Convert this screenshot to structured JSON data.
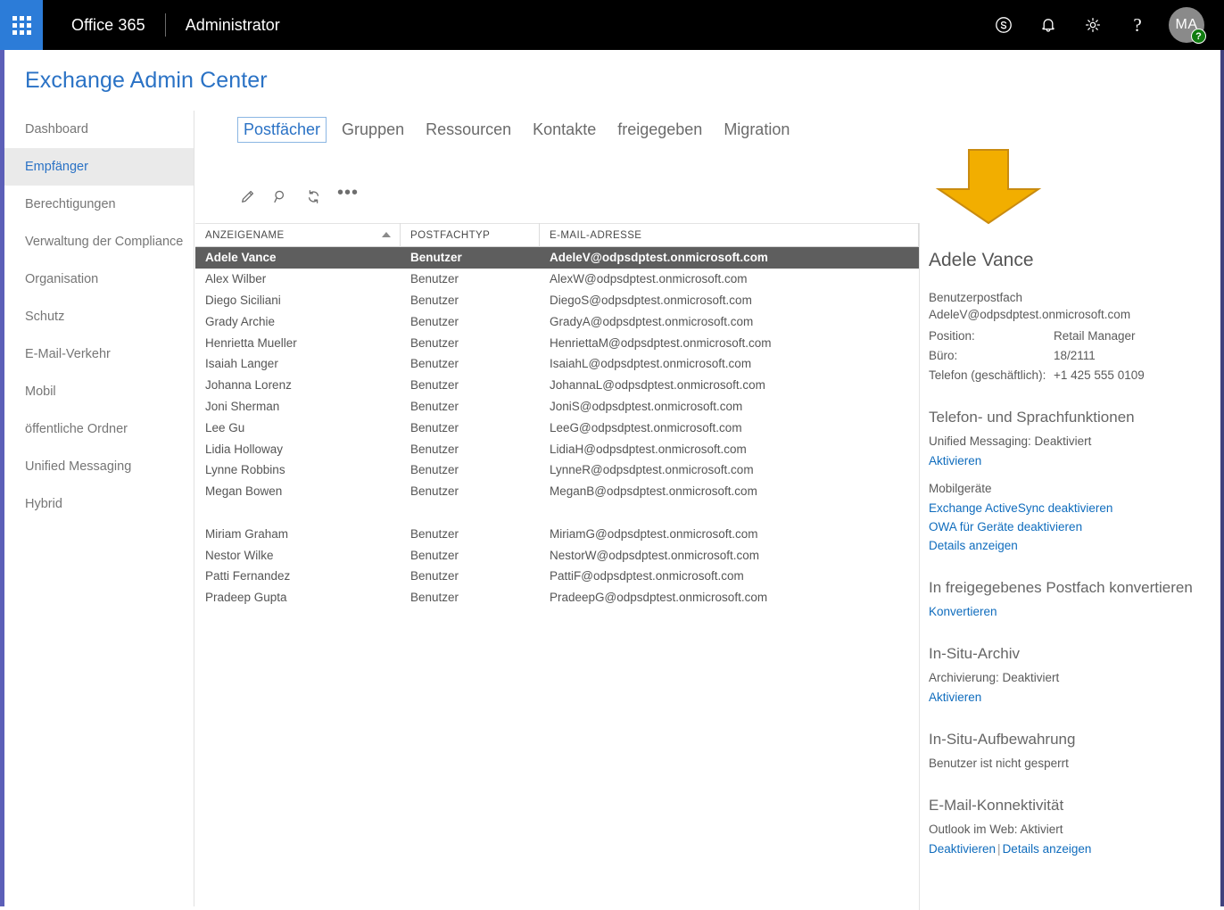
{
  "suitebar": {
    "waffle_label": "app-launcher",
    "brand": "Office 365",
    "subtitle": "Administrator",
    "icons": [
      "skype-icon",
      "bell-icon",
      "gear-icon",
      "help-icon"
    ],
    "help_glyph": "?",
    "avatar_initials": "MA",
    "avatar_badge_glyph": "?",
    "colors": {
      "bar_bg": "#000000",
      "waffle_bg": "#2c7cd8",
      "badge": "#107c10"
    }
  },
  "page": {
    "title": "Exchange Admin Center",
    "title_color": "#2a72c5"
  },
  "sidebar": {
    "items": [
      {
        "label": "Dashboard",
        "selected": false
      },
      {
        "label": "Empfänger",
        "selected": true
      },
      {
        "label": "Berechtigungen",
        "selected": false
      },
      {
        "label": "Verwaltung der Compliance",
        "selected": false
      },
      {
        "label": "Organisation",
        "selected": false
      },
      {
        "label": "Schutz",
        "selected": false
      },
      {
        "label": "E-Mail-Verkehr",
        "selected": false
      },
      {
        "label": "Mobil",
        "selected": false
      },
      {
        "label": "öffentliche Ordner",
        "selected": false
      },
      {
        "label": "Unified Messaging",
        "selected": false
      },
      {
        "label": "Hybrid",
        "selected": false
      }
    ]
  },
  "tabs": [
    {
      "label": "Postfächer",
      "active": true
    },
    {
      "label": "Gruppen",
      "active": false
    },
    {
      "label": "Ressourcen",
      "active": false
    },
    {
      "label": "Kontakte",
      "active": false
    },
    {
      "label": "freigegeben",
      "active": false
    },
    {
      "label": "Migration",
      "active": false
    }
  ],
  "toolbar": {
    "buttons": [
      "edit-pencil-icon",
      "search-icon",
      "refresh-icon",
      "more-options-icon"
    ],
    "more_glyph": "•••"
  },
  "table": {
    "columns": [
      "ANZEIGENAME",
      "POSTFACHTYP",
      "E-MAIL-ADRESSE"
    ],
    "sort_column": "ANZEIGENAME",
    "sort_direction": "ascending",
    "rows": [
      {
        "name": "Adele Vance",
        "type": "Benutzer",
        "email": "AdeleV@odpsdptest.onmicrosoft.com",
        "selected": true
      },
      {
        "name": "Alex Wilber",
        "type": "Benutzer",
        "email": "AlexW@odpsdptest.onmicrosoft.com",
        "selected": false
      },
      {
        "name": "Diego Siciliani",
        "type": "Benutzer",
        "email": "DiegoS@odpsdptest.onmicrosoft.com",
        "selected": false
      },
      {
        "name": "Grady Archie",
        "type": "Benutzer",
        "email": "GradyA@odpsdptest.onmicrosoft.com",
        "selected": false
      },
      {
        "name": "Henrietta Mueller",
        "type": "Benutzer",
        "email": "HenriettaM@odpsdptest.onmicrosoft.com",
        "selected": false
      },
      {
        "name": "Isaiah Langer",
        "type": "Benutzer",
        "email": "IsaiahL@odpsdptest.onmicrosoft.com",
        "selected": false
      },
      {
        "name": "Johanna Lorenz",
        "type": "Benutzer",
        "email": "JohannaL@odpsdptest.onmicrosoft.com",
        "selected": false
      },
      {
        "name": "Joni Sherman",
        "type": "Benutzer",
        "email": "JoniS@odpsdptest.onmicrosoft.com",
        "selected": false
      },
      {
        "name": "Lee Gu",
        "type": "Benutzer",
        "email": "LeeG@odpsdptest.onmicrosoft.com",
        "selected": false
      },
      {
        "name": "Lidia Holloway",
        "type": "Benutzer",
        "email": "LidiaH@odpsdptest.onmicrosoft.com",
        "selected": false
      },
      {
        "name": "Lynne Robbins",
        "type": "Benutzer",
        "email": "LynneR@odpsdptest.onmicrosoft.com",
        "selected": false
      },
      {
        "name": "Megan Bowen",
        "type": "Benutzer",
        "email": "MeganB@odpsdptest.onmicrosoft.com",
        "selected": false
      },
      {
        "name": "",
        "type": "",
        "email": "",
        "selected": false
      },
      {
        "name": "Miriam Graham",
        "type": "Benutzer",
        "email": "MiriamG@odpsdptest.onmicrosoft.com",
        "selected": false
      },
      {
        "name": "Nestor Wilke",
        "type": "Benutzer",
        "email": "NestorW@odpsdptest.onmicrosoft.com",
        "selected": false
      },
      {
        "name": "Patti Fernandez",
        "type": "Benutzer",
        "email": "PattiF@odpsdptest.onmicrosoft.com",
        "selected": false
      },
      {
        "name": "Pradeep Gupta",
        "type": "Benutzer",
        "email": "PradeepG@odpsdptest.onmicrosoft.com",
        "selected": false
      }
    ]
  },
  "details": {
    "display_name": "Adele Vance",
    "mailbox_type": "Benutzerpostfach",
    "email": "AdeleV@odpsdptest.onmicrosoft.com",
    "position_label": "Position:",
    "position_value": "Retail Manager",
    "office_label": "Büro:",
    "office_value": "18/2111",
    "phone_label": "Telefon (geschäftlich):",
    "phone_value": "+1 425 555 0109",
    "voice": {
      "heading": "Telefon- und Sprachfunktionen",
      "um_status": "Unified Messaging:  Deaktiviert",
      "um_link": "Aktivieren",
      "mobile_sub": "Mobilgeräte",
      "link_activesync": "Exchange ActiveSync deaktivieren",
      "link_owa_devices": "OWA für Geräte deaktivieren",
      "link_details": "Details anzeigen"
    },
    "convert": {
      "heading": "In freigegebenes Postfach konvertieren",
      "link": "Konvertieren"
    },
    "archive": {
      "heading": "In-Situ-Archiv",
      "status": "Archivierung:  Deaktiviert",
      "link": "Aktivieren"
    },
    "hold": {
      "heading": "In-Situ-Aufbewahrung",
      "status": "Benutzer ist nicht gesperrt"
    },
    "connectivity": {
      "heading": "E-Mail-Konnektivität",
      "status": "Outlook im Web:  Aktiviert",
      "link_disable": "Deaktivieren",
      "separator": "|",
      "link_details": "Details anzeigen"
    },
    "link_color": "#0f6cbd"
  },
  "annotation": {
    "type": "down-arrow",
    "color": "#F2AE00",
    "stroke": "#C98B10"
  }
}
